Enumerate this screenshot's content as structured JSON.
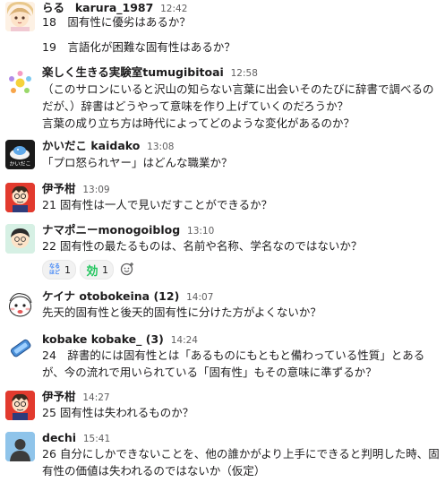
{
  "messages": [
    {
      "user": "らる",
      "handle": "karura_1987",
      "time": "12:42",
      "lines": [
        "18　固有性に優劣はあるか？",
        "",
        "19　言語化が困難な固有性はあるか？"
      ]
    },
    {
      "user": "楽しく生きる実験室tumugibitoai",
      "time": "12:58",
      "lines": [
        "（このサロンにいると沢山の知らない言葉に出会いそのたびに辞書で調べるの",
        "だが、）辞書はどうやって意味を作り上げていくのだろうか？",
        "言葉の成り立ち方は時代によってどのような変化があるのか？"
      ]
    },
    {
      "user": "かいだこ kaidako",
      "time": "13:08",
      "avatar_text": "かいだこ",
      "lines": [
        "「プロ怒られヤー」はどんな職業か？"
      ]
    },
    {
      "user": "伊予柑",
      "time": "13:09",
      "lines": [
        "21 固有性は一人で見いだすことができるか？"
      ]
    },
    {
      "user": "ナマポニーmonogoiblog",
      "time": "13:10",
      "lines": [
        "22 固有性の最たるものは、名前や名称、学名なのではないか？"
      ],
      "reactions": [
        {
          "emoji": "なるほど",
          "count": "1",
          "color": "#3b82f6"
        },
        {
          "emoji": "効",
          "count": "1",
          "color": "#22c55e"
        }
      ]
    },
    {
      "user": "ケイナ otobokeina (12)",
      "time": "14:07",
      "lines": [
        "先天的固有性と後天的固有性に分けた方がよくないか？"
      ]
    },
    {
      "user": "kobake kobake_ (3)",
      "time": "14:24",
      "lines": [
        "24　辞書的には固有性とは「あるものにもともと備わっている性質」とある",
        "が、今の流れで用いられている「固有性」もその意味に準ずるか？"
      ]
    },
    {
      "user": "伊予柑",
      "time": "14:27",
      "lines": [
        "25 固有性は失われるものか？"
      ]
    },
    {
      "user": "dechi",
      "time": "15:41",
      "lines": [
        "26 自分にしかできないことを、他の誰かがより上手にできると判明した時、固",
        "有性の価値は失われるのではないか（仮定）"
      ]
    }
  ]
}
